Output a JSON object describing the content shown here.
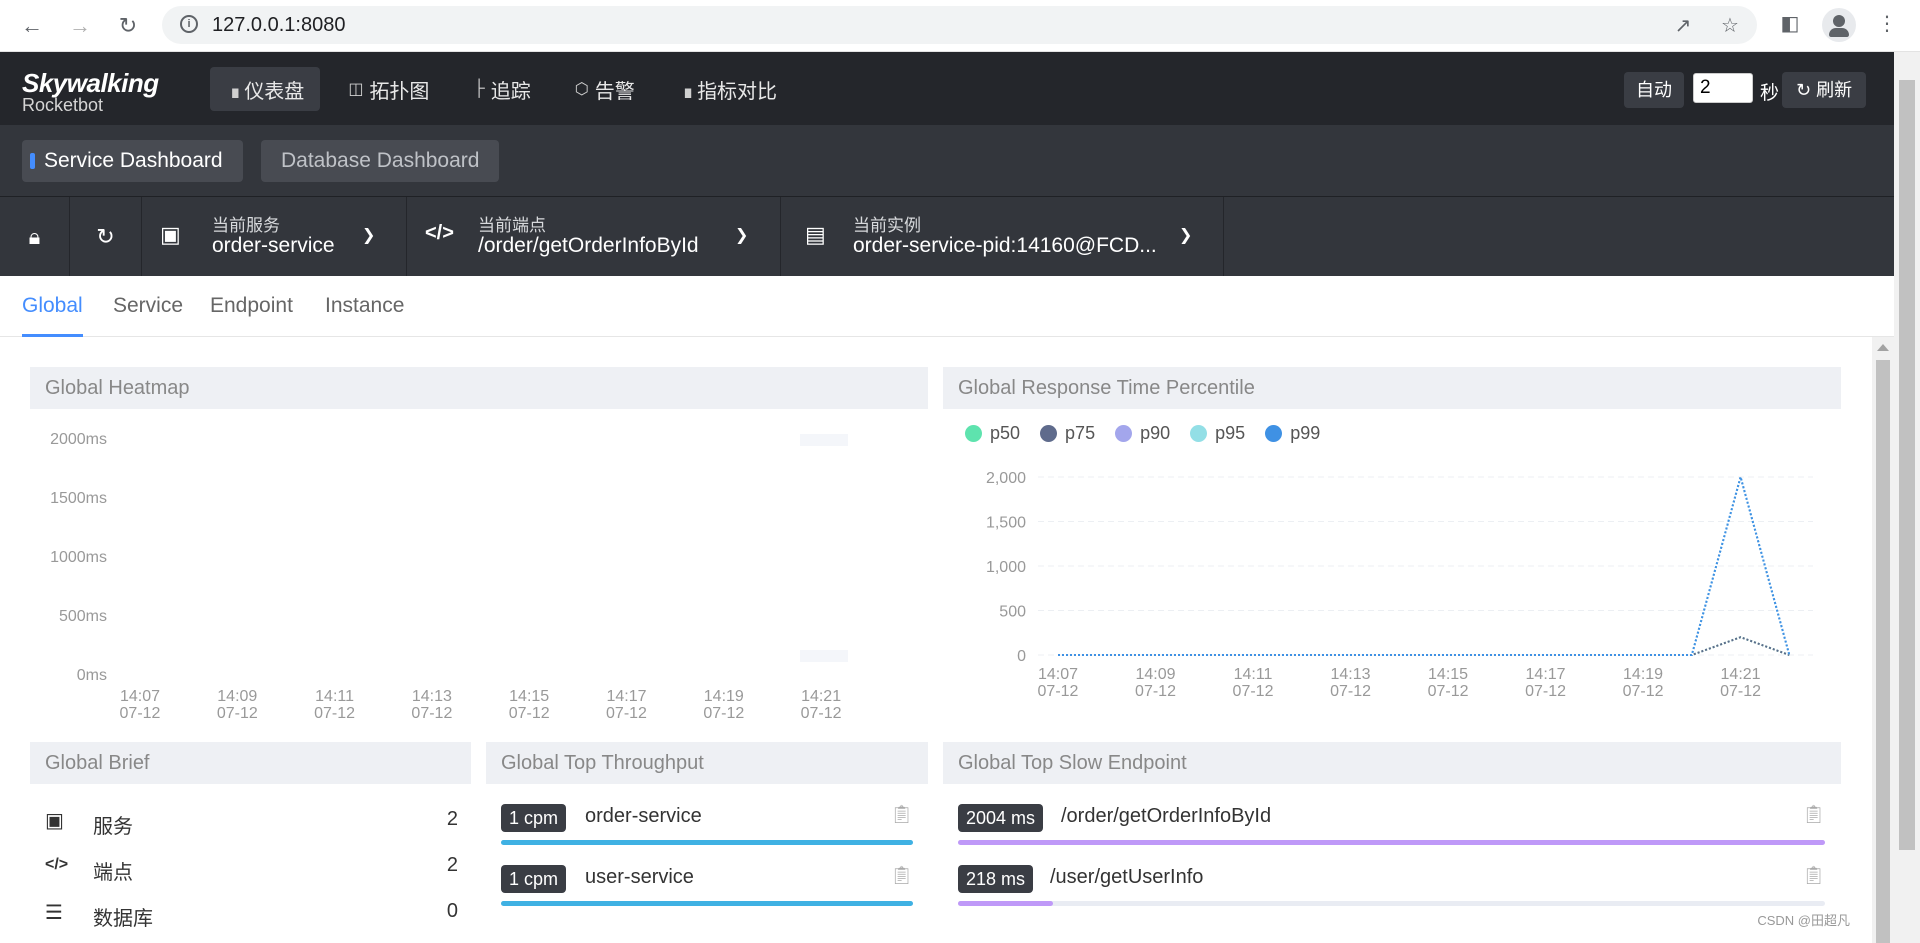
{
  "browser": {
    "url": "127.0.0.1:8080",
    "icons": [
      "back-icon",
      "forward-icon",
      "reload-icon",
      "info-icon",
      "share-icon",
      "star-icon",
      "sidepanel-icon",
      "profile-icon",
      "menu-icon"
    ]
  },
  "header": {
    "logo_main": "Skywalking",
    "logo_sub": "Rocketbot",
    "nav": [
      {
        "label": "仪表盘",
        "icon": "chart-icon",
        "active": true
      },
      {
        "label": "拓扑图",
        "icon": "topology-icon",
        "active": false
      },
      {
        "label": "追踪",
        "icon": "trace-icon",
        "active": false
      },
      {
        "label": "告警",
        "icon": "alarm-icon",
        "active": false
      },
      {
        "label": "指标对比",
        "icon": "compare-icon",
        "active": false
      }
    ],
    "auto_label": "自动",
    "interval_value": "2",
    "seconds_label": "秒",
    "refresh_label": "刷新"
  },
  "dashboards": [
    "Service Dashboard",
    "Database Dashboard"
  ],
  "selectors": {
    "service_label": "当前服务",
    "service_value": "order-service",
    "endpoint_label": "当前端点",
    "endpoint_value": "/order/getOrderInfoById",
    "instance_label": "当前实例",
    "instance_value": "order-service-pid:14160@FCD..."
  },
  "tabs": [
    "Global",
    "Service",
    "Endpoint",
    "Instance"
  ],
  "panels": {
    "heatmap_title": "Global Heatmap",
    "heatmap_y": [
      "2000ms",
      "1500ms",
      "1000ms",
      "500ms",
      "0ms"
    ],
    "percentile_title": "Global Response Time Percentile",
    "percentile_y": [
      "2,000",
      "1,500",
      "1,000",
      "500",
      "0"
    ],
    "x_ticks": [
      {
        "time": "14:07",
        "date": "07-12"
      },
      {
        "time": "14:09",
        "date": "07-12"
      },
      {
        "time": "14:11",
        "date": "07-12"
      },
      {
        "time": "14:13",
        "date": "07-12"
      },
      {
        "time": "14:15",
        "date": "07-12"
      },
      {
        "time": "14:17",
        "date": "07-12"
      },
      {
        "time": "14:19",
        "date": "07-12"
      },
      {
        "time": "14:21",
        "date": "07-12"
      }
    ],
    "brief_title": "Global Brief",
    "throughput_title": "Global Top Throughput",
    "slow_title": "Global Top Slow Endpoint"
  },
  "legend": [
    {
      "name": "p50",
      "color": "#5ee3ae"
    },
    {
      "name": "p75",
      "color": "#5f6b8c"
    },
    {
      "name": "p90",
      "color": "#a3a6ec"
    },
    {
      "name": "p95",
      "color": "#93dfe6"
    },
    {
      "name": "p99",
      "color": "#3f91e4"
    }
  ],
  "chart_data": {
    "type": "line",
    "title": "Global Response Time Percentile",
    "categories": [
      "14:07",
      "14:08",
      "14:09",
      "14:10",
      "14:11",
      "14:12",
      "14:13",
      "14:14",
      "14:15",
      "14:16",
      "14:17",
      "14:18",
      "14:19",
      "14:20",
      "14:21",
      "14:22"
    ],
    "ylim": [
      0,
      2000
    ],
    "series": [
      {
        "name": "p50",
        "color": "#5ee3ae",
        "values": [
          0,
          0,
          0,
          0,
          0,
          0,
          0,
          0,
          0,
          0,
          0,
          0,
          0,
          0,
          200,
          0
        ]
      },
      {
        "name": "p75",
        "color": "#5f6b8c",
        "values": [
          0,
          0,
          0,
          0,
          0,
          0,
          0,
          0,
          0,
          0,
          0,
          0,
          0,
          0,
          200,
          0
        ]
      },
      {
        "name": "p90",
        "color": "#a3a6ec",
        "values": [
          0,
          0,
          0,
          0,
          0,
          0,
          0,
          0,
          0,
          0,
          0,
          0,
          0,
          0,
          2000,
          0
        ]
      },
      {
        "name": "p95",
        "color": "#93dfe6",
        "values": [
          0,
          0,
          0,
          0,
          0,
          0,
          0,
          0,
          0,
          0,
          0,
          0,
          0,
          0,
          2000,
          0
        ]
      },
      {
        "name": "p99",
        "color": "#3f91e4",
        "values": [
          0,
          0,
          0,
          0,
          0,
          0,
          0,
          0,
          0,
          0,
          0,
          0,
          0,
          0,
          2000,
          0
        ]
      }
    ]
  },
  "brief": [
    {
      "label": "服务",
      "value": "2",
      "icon": "service-icon"
    },
    {
      "label": "端点",
      "value": "2",
      "icon": "endpoint-icon"
    },
    {
      "label": "数据库",
      "value": "0",
      "icon": "database-icon"
    }
  ],
  "throughput": [
    {
      "badge": "1 cpm",
      "name": "order-service",
      "ratio": 1.0,
      "color": "#3fb1e3"
    },
    {
      "badge": "1 cpm",
      "name": "user-service",
      "ratio": 1.0,
      "color": "#3fb1e3"
    }
  ],
  "slow_endpoints": [
    {
      "badge": "2004 ms",
      "name": "/order/getOrderInfoById",
      "ratio": 1.0,
      "color": "#bf99f8"
    },
    {
      "badge": "218 ms",
      "name": "/user/getUserInfo",
      "ratio": 0.109,
      "color": "#bf99f8"
    }
  ],
  "watermark": "CSDN @田超凡"
}
